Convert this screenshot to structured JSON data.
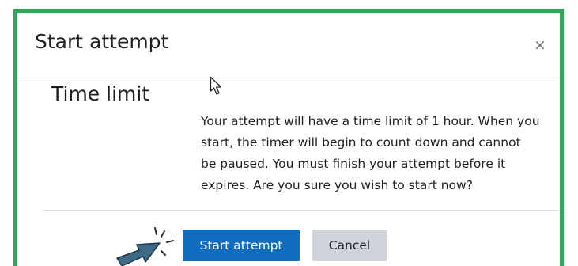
{
  "dialog": {
    "title": "Start attempt",
    "close_symbol": "×",
    "close_icon": "close-icon"
  },
  "body": {
    "section_title": "Time limit",
    "lines": [
      "Your attempt will have a time limit of 1 hour. When you",
      "start, the timer will begin to count down and cannot",
      "be paused. You must finish your attempt before it",
      "expires. Are you sure you wish to start now?"
    ]
  },
  "footer": {
    "start_label": "Start attempt",
    "cancel_label": "Cancel"
  },
  "annotations": {
    "mouse_cursor_icon": "mouse-cursor-icon",
    "pointer_arrow_icon": "pointer-arrow-icon"
  },
  "colors": {
    "highlight_frame": "#2ea75a",
    "primary_button": "#0f6cbf",
    "secondary_button": "#ced4da",
    "pointer_arrow": "#3e6a86"
  }
}
